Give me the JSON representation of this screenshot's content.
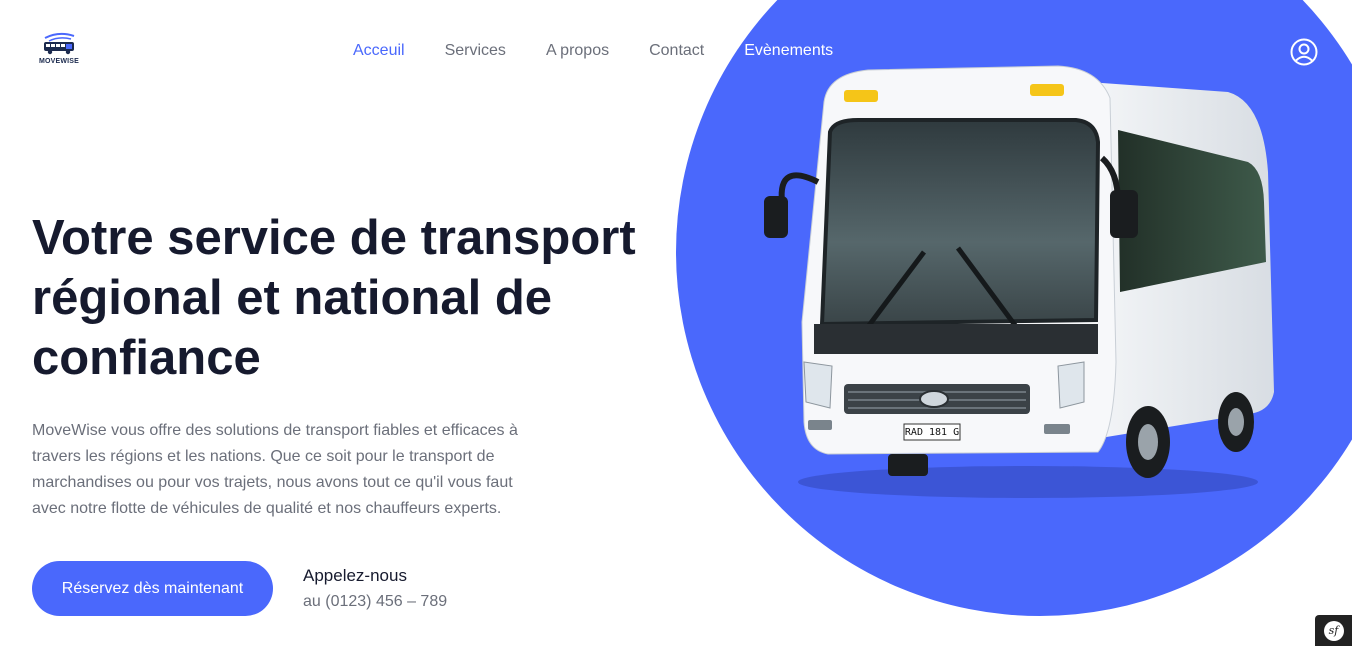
{
  "brand": {
    "logo_text": "MOVEWISE"
  },
  "nav": {
    "items": [
      {
        "label": "Acceuil",
        "active": true
      },
      {
        "label": "Services",
        "active": false
      },
      {
        "label": "A propos",
        "active": false
      },
      {
        "label": "Contact",
        "active": false
      },
      {
        "label": "Evènements",
        "active": false
      }
    ]
  },
  "hero": {
    "title": "Votre service de transport régional et national de confiance",
    "description": "MoveWise vous offre des solutions de transport fiables et efficaces à travers les régions et les nations. Que ce soit pour le transport de marchandises ou pour vos trajets, nous avons tout ce qu'il vous faut avec notre flotte de véhicules de qualité et nos chauffeurs experts.",
    "cta_label": "Réservez dès maintenant",
    "call_label": "Appelez-nous",
    "call_number": "au (0123) 456 – 789",
    "bus_plate": "RAD 181 G"
  },
  "debug_toolbar": {
    "glyph": "sf"
  },
  "colors": {
    "accent": "#4a68fc",
    "heading": "#161a2e",
    "body_text": "#6b6f7a",
    "background": "#ffffff"
  },
  "icons": {
    "logo": "bus-logo-icon",
    "user": "user-account-icon",
    "debug": "symfony-icon"
  }
}
